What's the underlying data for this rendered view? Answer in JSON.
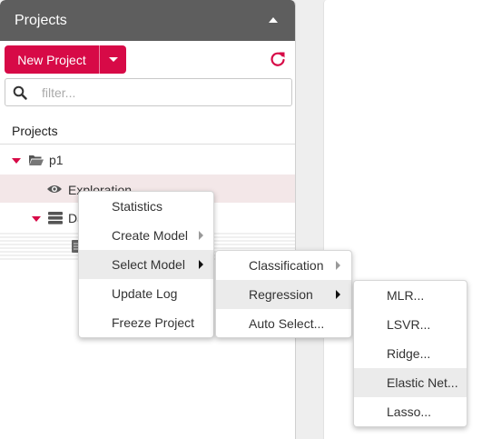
{
  "sidebar": {
    "header_title": "Projects",
    "new_project_label": "New Project",
    "filter_placeholder": "filter...",
    "tree_title": "Projects",
    "tree": {
      "project_label": "p1",
      "exploration_label": "Exploration",
      "data_label": "Da"
    }
  },
  "context_menu": {
    "items": [
      "Statistics",
      "Create Model",
      "Select Model",
      "Update Log",
      "Freeze Project"
    ],
    "active": "Select Model"
  },
  "select_model_submenu": {
    "items": [
      "Classification",
      "Regression",
      "Auto Select..."
    ],
    "active": "Regression"
  },
  "regression_submenu": {
    "items": [
      "MLR...",
      "LSVR...",
      "Ridge...",
      "Elastic Net...",
      "Lasso..."
    ],
    "active": "Elastic Net..."
  },
  "colors": {
    "accent": "#d70a47",
    "header_bg": "#5e5e5e",
    "selected_row_bg": "#f3e7e8",
    "menu_hover_bg": "#ebebeb"
  }
}
